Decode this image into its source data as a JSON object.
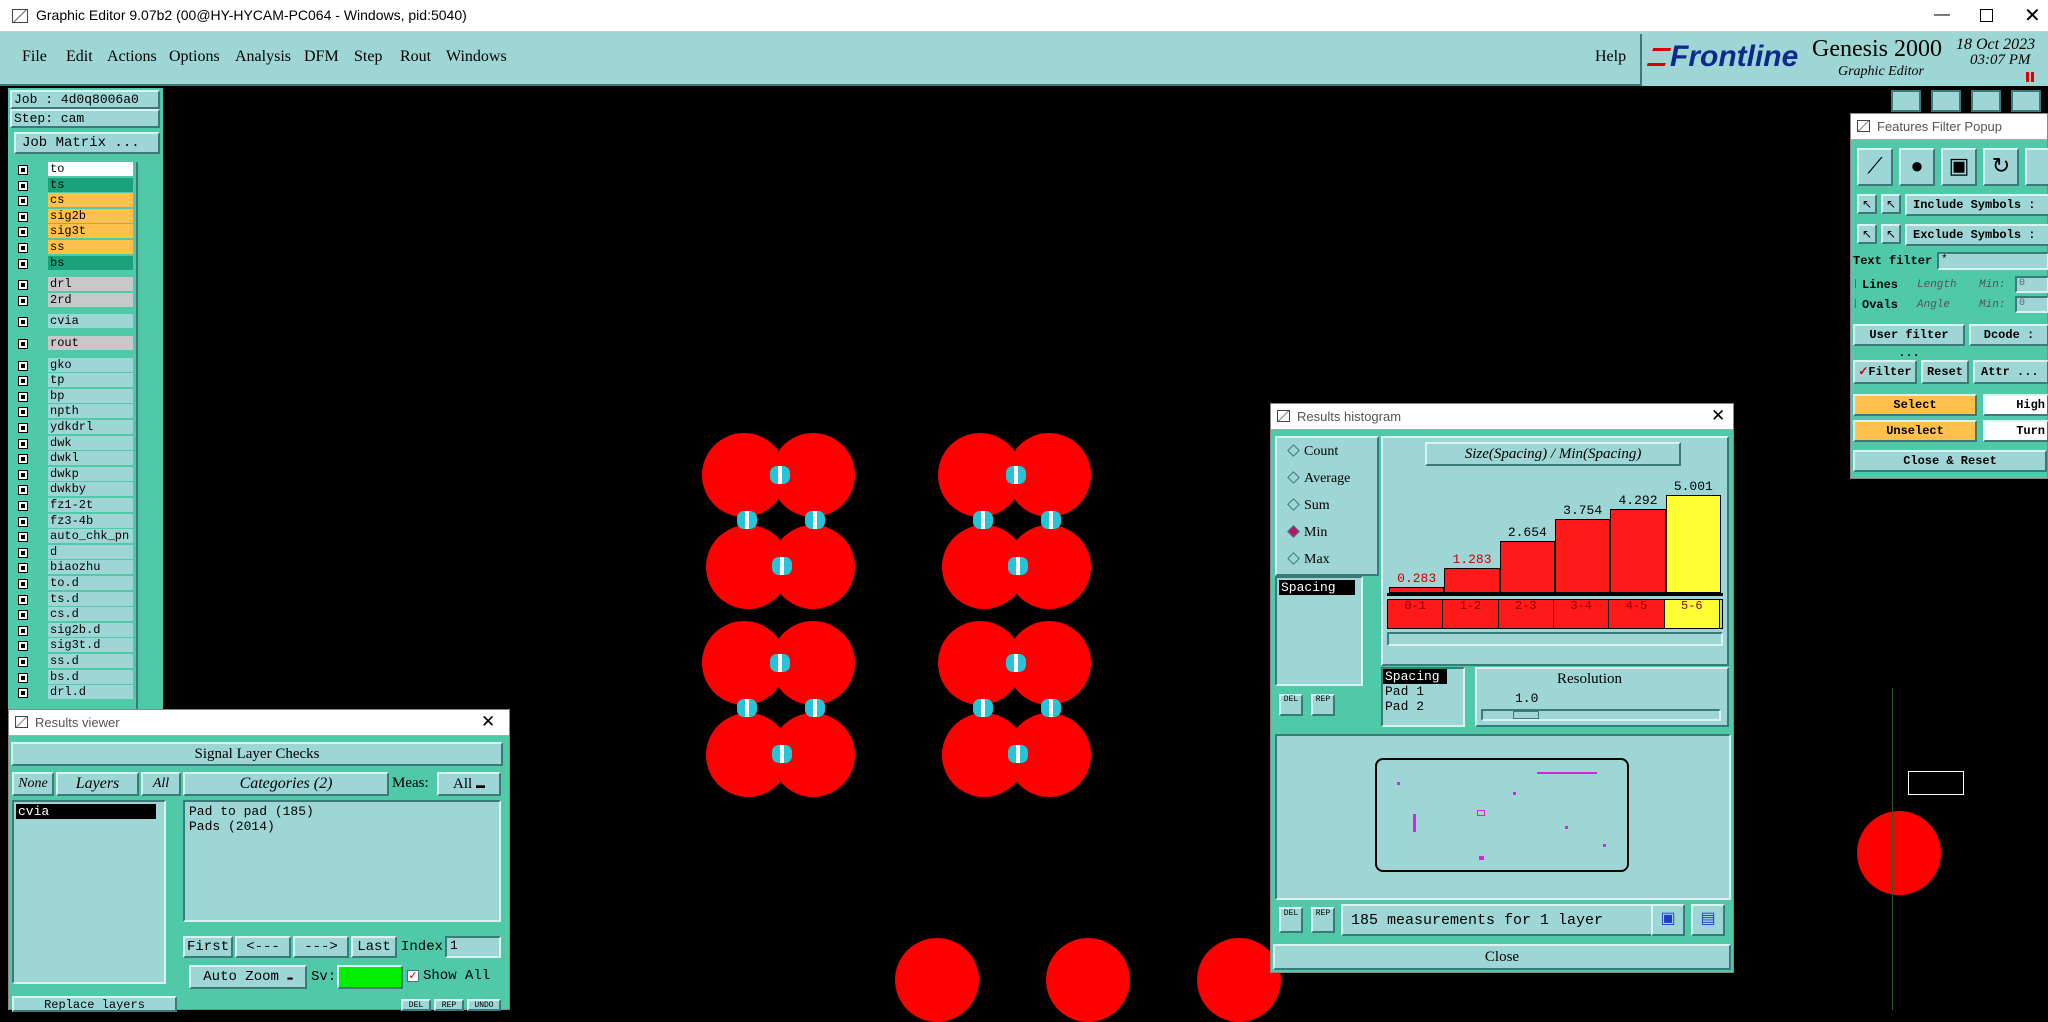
{
  "window_title": "Graphic Editor 9.07b2 (00@HY-HYCAM-PC064 - Windows, pid:5040)",
  "menu": [
    "File",
    "Edit",
    "Actions",
    "Options",
    "Analysis",
    "DFM",
    "Step",
    "Rout",
    "Windows"
  ],
  "help": "Help",
  "brand": {
    "logo": "Frontline",
    "product": "Genesis 2000",
    "subtitle": "Graphic Editor",
    "date": "18 Oct 2023",
    "time": "03:07 PM"
  },
  "job": {
    "job": "Job : 4d0q8006a0",
    "step": "Step: cam",
    "matrix_button": "Job Matrix ..."
  },
  "layers": [
    {
      "name": "to",
      "color": "#ffffff"
    },
    {
      "name": "ts",
      "color": "#1aa37a"
    },
    {
      "name": "cs",
      "color": "#ffc04d"
    },
    {
      "name": "sig2b",
      "color": "#ffc04d"
    },
    {
      "name": "sig3t",
      "color": "#ffc04d"
    },
    {
      "name": "ss",
      "color": "#ffc04d"
    },
    {
      "name": "bs",
      "color": "#1aa37a"
    },
    {
      "name": "drl",
      "color": "#c8c8c8"
    },
    {
      "name": "2rd",
      "color": "#c8c8c8"
    },
    {
      "name": "cvia",
      "color": "#9ed6d6"
    },
    {
      "name": "rout",
      "color": "#c8c8c8"
    },
    {
      "name": "gko",
      "color": "#9ed6d6"
    },
    {
      "name": "tp",
      "color": "#9ed6d6"
    },
    {
      "name": "bp",
      "color": "#9ed6d6"
    },
    {
      "name": "npth",
      "color": "#9ed6d6"
    },
    {
      "name": "ydkdrl",
      "color": "#9ed6d6"
    },
    {
      "name": "dwk",
      "color": "#9ed6d6"
    },
    {
      "name": "dwkl",
      "color": "#9ed6d6"
    },
    {
      "name": "dwkp",
      "color": "#9ed6d6"
    },
    {
      "name": "dwkby",
      "color": "#9ed6d6"
    },
    {
      "name": "fz1-2t",
      "color": "#9ed6d6"
    },
    {
      "name": "fz3-4b",
      "color": "#9ed6d6"
    },
    {
      "name": "auto_chk_pn",
      "color": "#9ed6d6"
    },
    {
      "name": "d",
      "color": "#9ed6d6"
    },
    {
      "name": "biaozhu",
      "color": "#9ed6d6"
    },
    {
      "name": "to.d",
      "color": "#9ed6d6"
    },
    {
      "name": "ts.d",
      "color": "#9ed6d6"
    },
    {
      "name": "cs.d",
      "color": "#9ed6d6"
    },
    {
      "name": "sig2b.d",
      "color": "#9ed6d6"
    },
    {
      "name": "sig3t.d",
      "color": "#9ed6d6"
    },
    {
      "name": "ss.d",
      "color": "#9ed6d6"
    },
    {
      "name": "bs.d",
      "color": "#9ed6d6"
    },
    {
      "name": "drl.d",
      "color": "#9ed6d6"
    }
  ],
  "results_viewer": {
    "title": "Results viewer",
    "header": "Signal Layer Checks",
    "none": "None",
    "layers": "Layers",
    "all": "All",
    "categories": "Categories (2)",
    "meas_label": "Meas:",
    "meas_value": "All",
    "layer_item": "cvia",
    "category_items": [
      "Pad to pad (185)",
      "Pads (2014)"
    ],
    "first": "First",
    "prev": "<---",
    "next": "--->",
    "last": "Last",
    "index_label": "Index:",
    "index_value": "1",
    "auto_zoom": "Auto Zoom",
    "sv_label": "Sv:",
    "show_all": "Show All",
    "replace_layers": "Replace layers",
    "tiny_buttons": [
      "DEL",
      "REP",
      "UNDO"
    ]
  },
  "histogram": {
    "title": "Results histogram",
    "chart_title": "Size(Spacing) / Min(Spacing)",
    "radio": [
      {
        "label": "Count",
        "selected": false
      },
      {
        "label": "Average",
        "selected": false
      },
      {
        "label": "Sum",
        "selected": false
      },
      {
        "label": "Min",
        "selected": true
      },
      {
        "label": "Max",
        "selected": false
      }
    ],
    "list_item": "Spacing",
    "res_list": [
      "Spacing",
      "Pad 1",
      "Pad 2"
    ],
    "resolution_label": "Resolution",
    "resolution_value": "1.0",
    "status": "185 measurements for 1 layer",
    "close": "Close",
    "tiny_buttons": [
      "DEL",
      "REP"
    ]
  },
  "chart_data": {
    "type": "bar",
    "title": "Size(Spacing) / Min(Spacing)",
    "categories": [
      "0-1",
      "1-2",
      "2-3",
      "3-4",
      "4-5",
      "5-6"
    ],
    "values": [
      0.283,
      1.283,
      2.654,
      3.754,
      4.292,
      5.001
    ],
    "value_labels": [
      "0.283",
      "1.283",
      "2.654",
      "3.754",
      "4.292",
      "5.001"
    ],
    "colors": [
      "#ff1a1a",
      "#ff1a1a",
      "#ff1a1a",
      "#ff1a1a",
      "#ff1a1a",
      "#ffff33"
    ],
    "ylim": [
      0,
      5.5
    ]
  },
  "filter_popup": {
    "title": "Features Filter Popup",
    "include": "Include Symbols :",
    "exclude": "Exclude Symbols :",
    "text_filter_label": "Text filter",
    "text_filter_value": "*",
    "lines": "Lines",
    "ovals": "Ovals",
    "length": "Length",
    "angle": "Angle",
    "min": "Min:",
    "min_value": "0",
    "user_filter": "User filter ...",
    "dcode": "Dcode :",
    "filter": "Filter",
    "reset": "Reset",
    "attr": "Attr ...",
    "select": "Select",
    "unselect": "Unselect",
    "highlight": "High",
    "turn": "Turn",
    "close_reset": "Close & Reset"
  }
}
